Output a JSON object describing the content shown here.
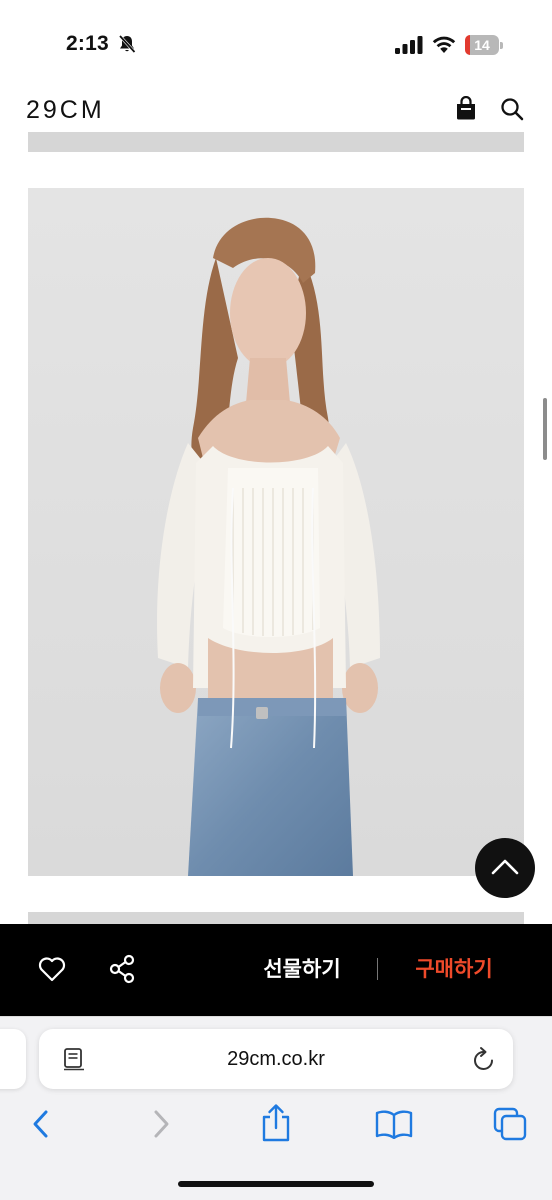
{
  "status_bar": {
    "time": "2:13",
    "battery_level": "14",
    "icons": [
      "bell-slash-icon",
      "signal-icon",
      "wifi-icon",
      "battery-icon"
    ]
  },
  "header": {
    "logo": "29CM",
    "icons": [
      "shopping-bag-icon",
      "search-icon"
    ]
  },
  "product": {
    "image": "product-photo"
  },
  "action_bar": {
    "gift_label": "선물하기",
    "buy_label": "구매하기",
    "buy_color": "#ef4a2a",
    "icons": [
      "heart-icon",
      "share-icon"
    ]
  },
  "browser": {
    "url": "29cm.co.kr",
    "icons": [
      "reader-icon",
      "reload-icon",
      "back-icon",
      "forward-icon",
      "share-icon",
      "bookmarks-icon",
      "tabs-icon"
    ]
  }
}
